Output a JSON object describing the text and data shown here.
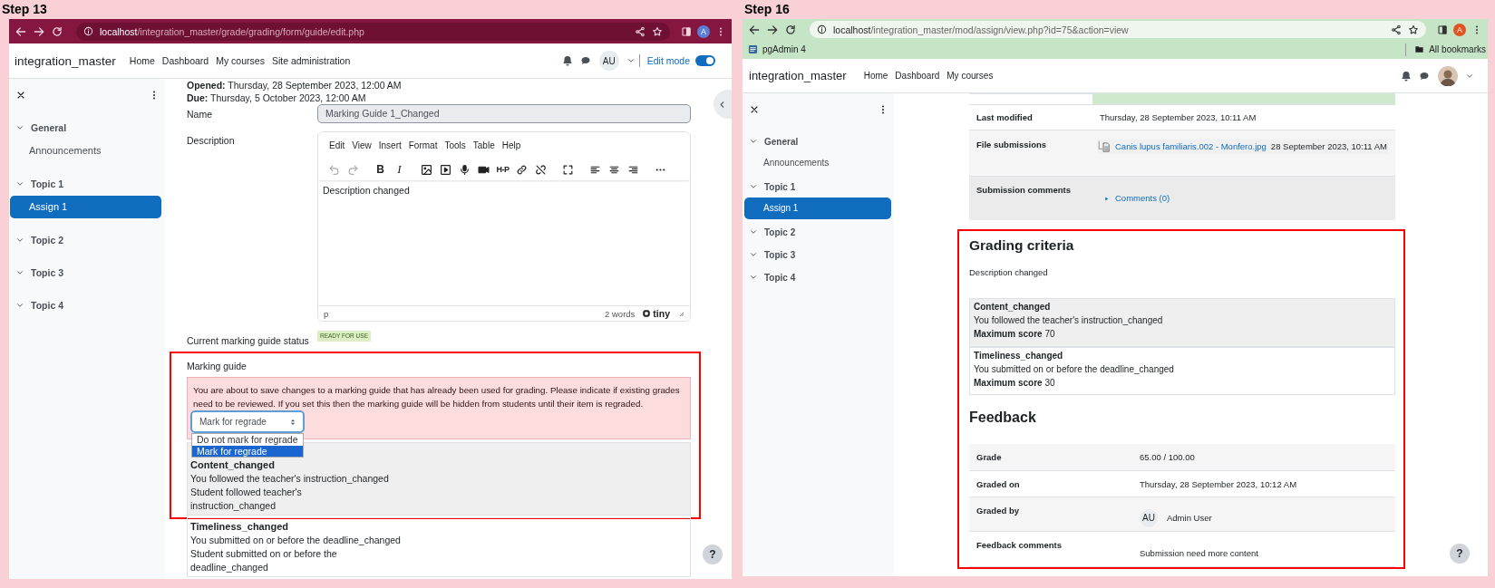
{
  "screens": [
    {
      "kind": "guide_edit",
      "step": "Step 13",
      "browser": {
        "host": "localhost",
        "path": "/integration_master/grade/grading/form/guide/edit.php",
        "profile": "A"
      },
      "site": {
        "name": "integration_master",
        "nav": [
          "Home",
          "Dashboard",
          "My courses",
          "Site administration"
        ],
        "user": "AU",
        "edit_mode": {
          "label": "Edit mode",
          "on": true
        }
      },
      "sidebar": [
        {
          "title": "General",
          "children": [
            {
              "label": "Announcements",
              "selected": false
            }
          ]
        },
        {
          "title": "Topic 1",
          "children": [
            {
              "label": "Assign 1",
              "selected": true
            }
          ]
        },
        {
          "title": "Topic 2"
        },
        {
          "title": "Topic 3"
        },
        {
          "title": "Topic 4"
        }
      ],
      "dates": [
        {
          "label": "Opened:",
          "value": "Thursday, 28 September 2023, 12:00 AM"
        },
        {
          "label": "Due:",
          "value": "Thursday, 5 October 2023, 12:00 AM"
        }
      ],
      "name_field": {
        "label": "Name",
        "value": "Marking Guide 1_Changed"
      },
      "description": {
        "label": "Description",
        "menu": [
          "Edit",
          "View",
          "Insert",
          "Format",
          "Tools",
          "Table",
          "Help"
        ],
        "toolbar_text": [
          "B",
          "I",
          "H-P"
        ],
        "content": "Description changed",
        "path": "p",
        "word_count": "2 words",
        "brand": "tiny"
      },
      "status": {
        "label": "Current marking guide status",
        "badge": "READY FOR USE"
      },
      "marking_guide": {
        "label": "Marking guide",
        "alert": "You are about to save changes to a marking guide that has already been used for grading. Please indicate if existing grades need to be reviewed. If you set this then the marking guide will be hidden from students until their item is regraded.",
        "select": {
          "value": "Mark for regrade",
          "open": true,
          "options": [
            {
              "label": "Do not mark for regrade",
              "selected": false
            },
            {
              "label": "Mark for regrade",
              "selected": true
            }
          ]
        },
        "criteria": [
          {
            "name": "Content_changed",
            "lines": [
              "You followed the teacher's instruction_changed",
              "Student followed teacher's",
              "instruction_changed"
            ],
            "highlighted": true
          },
          {
            "name": "Timeliness_changed",
            "lines": [
              "You submitted on or before the deadline_changed",
              "Student submitted on or before the",
              "deadline_changed"
            ],
            "highlighted": false
          }
        ]
      },
      "help": "?"
    },
    {
      "kind": "assignment_view",
      "step": "Step 16",
      "browser": {
        "host": "localhost",
        "path": "/integration_master/mod/assign/view.php?id=75&action=view",
        "profile": "A"
      },
      "bookmarks": {
        "items": [
          "pgAdmin 4"
        ],
        "all": "All bookmarks"
      },
      "site": {
        "name": "integration_master",
        "nav": [
          "Home",
          "Dashboard",
          "My courses"
        ]
      },
      "sidebar": [
        {
          "title": "General",
          "children": [
            {
              "label": "Announcements",
              "selected": false
            }
          ]
        },
        {
          "title": "Topic 1",
          "children": [
            {
              "label": "Assign 1",
              "selected": true
            }
          ]
        },
        {
          "title": "Topic 2"
        },
        {
          "title": "Topic 3"
        },
        {
          "title": "Topic 4"
        }
      ],
      "submission": [
        {
          "kind": "status"
        },
        {
          "kind": "text",
          "label": "Last modified",
          "value": "Thursday, 28 September 2023, 10:11 AM"
        },
        {
          "kind": "file",
          "label": "File submissions",
          "file": "Canis lupus familiaris.002 - Monfero.jpg",
          "date": "28 September 2023, 10:11 AM"
        },
        {
          "kind": "comments",
          "label": "Submission comments",
          "link": "Comments (0)"
        }
      ],
      "grading_criteria": {
        "title": "Grading criteria",
        "description": "Description changed",
        "highlighted": true,
        "criteria": [
          {
            "name": "Content_changed",
            "description": "You followed the teacher's instruction_changed",
            "score_label": "Maximum score",
            "score": "70"
          },
          {
            "name": "Timeliness_changed",
            "description": "You submitted on or before the deadline_changed",
            "score_label": "Maximum score",
            "score": "30"
          }
        ]
      },
      "feedback": {
        "title": "Feedback",
        "highlighted": true,
        "rows": [
          {
            "kind": "text",
            "label": "Grade",
            "value": "65.00 / 100.00"
          },
          {
            "kind": "text",
            "label": "Graded on",
            "value": "Thursday, 28 September 2023, 10:12 AM"
          },
          {
            "kind": "user",
            "label": "Graded by",
            "initials": "AU",
            "value": "Admin User"
          },
          {
            "kind": "comment",
            "label": "Feedback comments",
            "value": "Submission need more content"
          }
        ]
      },
      "help": "?"
    }
  ]
}
